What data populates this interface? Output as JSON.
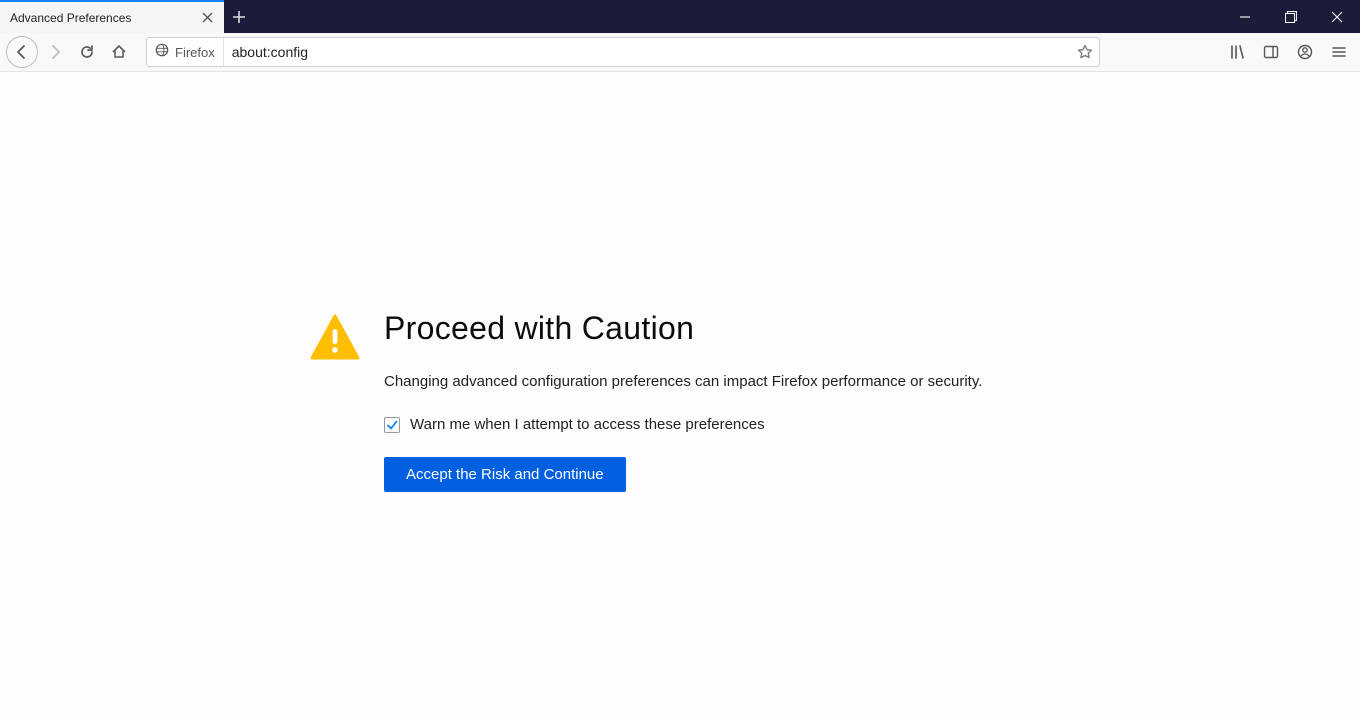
{
  "tab": {
    "title": "Advanced Preferences"
  },
  "urlbar": {
    "identity_label": "Firefox",
    "url": "about:config"
  },
  "warning": {
    "title": "Proceed with Caution",
    "description": "Changing advanced configuration preferences can impact Firefox performance or security.",
    "checkbox_label": "Warn me when I attempt to access these preferences",
    "checkbox_checked": true,
    "accept_label": "Accept the Risk and Continue"
  },
  "colors": {
    "accent": "#0a84ff",
    "button": "#0060df",
    "titlebar": "#1b1b3a",
    "warn_icon": "#ffbf00"
  }
}
